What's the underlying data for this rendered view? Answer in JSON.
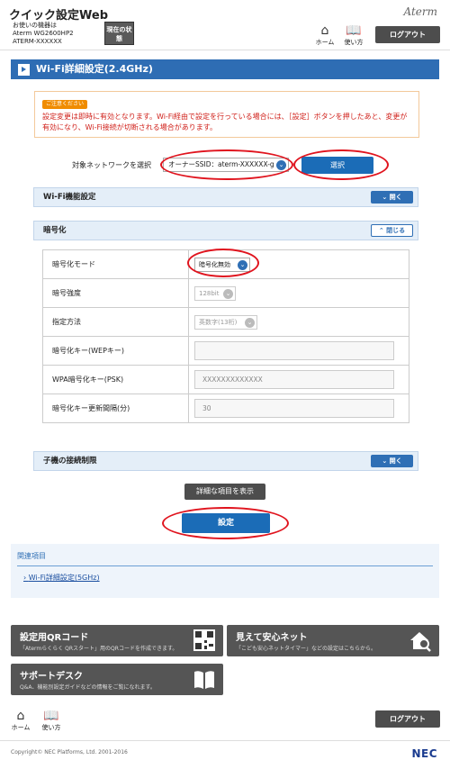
{
  "header": {
    "app_title": "クイック設定Web",
    "device_label": "お使いの機器は",
    "device_model": "Aterm WG2600HP2",
    "device_id": "ATERM-XXXXXX",
    "status_button": "現在の状態",
    "brand": "Aterm",
    "home_label": "ホーム",
    "manual_label": "使い方",
    "logout_label": "ログアウト"
  },
  "page_title": "Wi-Fi詳細設定(2.4GHz)",
  "notice": {
    "badge": "ご注意ください",
    "text": "設定変更は即時に有効となります。Wi-Fi経由で設定を行っている場合には、［設定］ボタンを押したあと、変更が有効になり、Wi-Fi接続が切断される場合があります。"
  },
  "network": {
    "label": "対象ネットワークを選択",
    "selected": "オーナーSSID：aterm-XXXXXX-g",
    "select_button": "選択"
  },
  "sections": {
    "wifi_function": {
      "title": "Wi-Fi機能設定",
      "toggle": "開く"
    },
    "encryption": {
      "title": "暗号化",
      "toggle": "閉じる"
    },
    "client_restriction": {
      "title": "子機の接続制限",
      "toggle": "開く"
    }
  },
  "encryption_rows": {
    "mode": {
      "label": "暗号化モード",
      "value": "暗号化無効"
    },
    "strength": {
      "label": "暗号強度",
      "value": "128bit"
    },
    "method": {
      "label": "指定方法",
      "value": "英数字(13桁)"
    },
    "wep_key": {
      "label": "暗号化キー(WEPキー)",
      "value": ""
    },
    "psk": {
      "label": "WPA暗号化キー(PSK)",
      "value": "XXXXXXXXXXXXX"
    },
    "interval": {
      "label": "暗号化キー更新間隔(分)",
      "value": "30"
    }
  },
  "buttons": {
    "show_details": "詳細な項目を表示",
    "apply": "設定"
  },
  "related": {
    "title": "関連項目",
    "link": "Wi-Fi詳細設定(5GHz)"
  },
  "tiles": {
    "qr": {
      "title": "設定用QRコード",
      "sub": "「Atermらくらく QRスタート」用のQRコードを作成できます。"
    },
    "safety": {
      "title": "見えて安心ネット",
      "sub": "「こども安心ネットタイマー」などの設定はこちらから。"
    },
    "support": {
      "title": "サポートデスク",
      "sub": "Q&A、機能別設定ガイドなどの情報をご覧になれます。"
    }
  },
  "footer": {
    "home_label": "ホーム",
    "manual_label": "使い方",
    "logout_label": "ログアウト",
    "copyright": "Copyright© NEC Platforms, Ltd. 2001-2016",
    "nec": "NEC"
  },
  "colors": {
    "primary_blue": "#2e6db4",
    "button_blue": "#1b6cb7",
    "dark_button": "#4d4d4d",
    "warning_red": "#d0201a",
    "highlight_oval": "#e0141e"
  }
}
